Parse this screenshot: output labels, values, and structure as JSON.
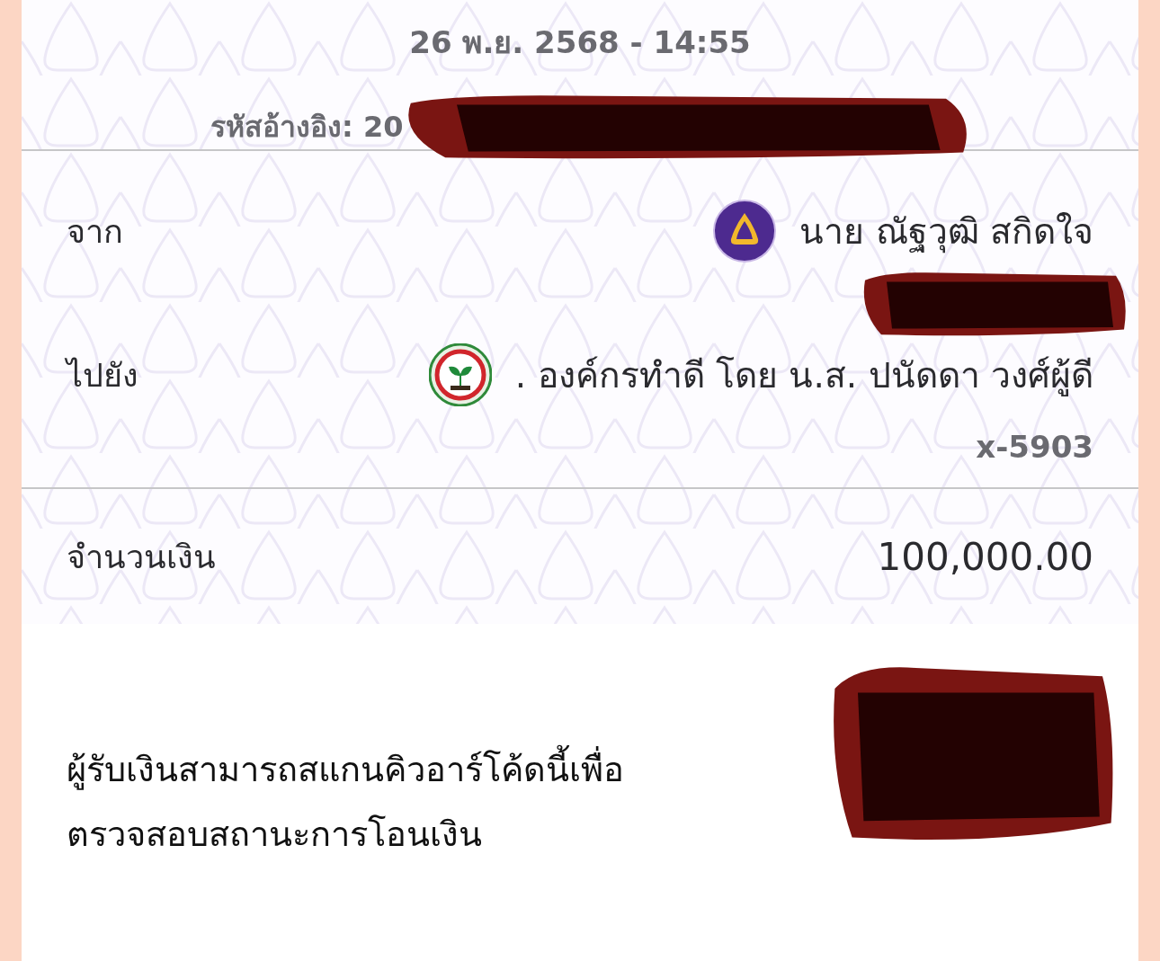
{
  "header": {
    "datetime": "26 พ.ย. 2568 - 14:55",
    "reference_label": "รหัสอ้างอิง: 20",
    "reference_redacted": true
  },
  "from": {
    "label": "จาก",
    "name": "นาย ณัฐวุฒิ สกิดใจ",
    "account_redacted": true
  },
  "to": {
    "label": "ไปยัง",
    "name": ". องค์กรทำดี โดย น.ส. ปนัดดา  วงศ์ผู้ดี",
    "account": "x-5903"
  },
  "amount": {
    "label": "จำนวนเงิน",
    "value": "100,000.00"
  },
  "qr": {
    "note_lines": [
      "ผู้รับเงินสามารถสแกนคิวอาร์โค้ดนี้เพื่อ",
      "ตรวจสอบสถานะการโอนเงิน"
    ],
    "redacted": true
  }
}
